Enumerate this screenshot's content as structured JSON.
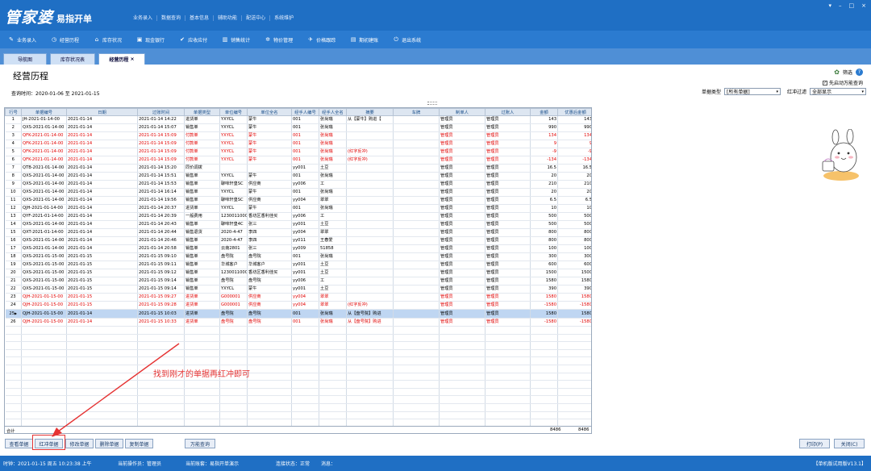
{
  "app": {
    "logo": "管家婆",
    "subtitle": "易指开单",
    "top_menu": [
      "业务录入",
      "数据查询",
      "基本信息",
      "辅助功能",
      "配送中心",
      "系统维护"
    ],
    "window_controls": [
      "▾",
      "–",
      "□",
      "×"
    ]
  },
  "toolbar": [
    {
      "label": "业务录入",
      "icon": "pencil-icon"
    },
    {
      "label": "经营历程",
      "icon": "clock-icon"
    },
    {
      "label": "库存状况",
      "icon": "house-icon"
    },
    {
      "label": "现金银行",
      "icon": "cash-icon"
    },
    {
      "label": "应收应付",
      "icon": "check-icon"
    },
    {
      "label": "销售统计",
      "icon": "chart-icon"
    },
    {
      "label": "物价管理",
      "icon": "gear-icon"
    },
    {
      "label": "价格跟踪",
      "icon": "pin-icon"
    },
    {
      "label": "期初建账",
      "icon": "ledger-icon"
    },
    {
      "label": "退出系统",
      "icon": "power-icon"
    }
  ],
  "tabs": [
    {
      "label": "导航图"
    },
    {
      "label": "库存状况表"
    },
    {
      "label": "经营历程",
      "close": "×"
    }
  ],
  "page": {
    "title": "经营历程",
    "query_time": "查询时间：2020-01-06 至 2021-01-15",
    "filter_link": "筛选",
    "help": "?",
    "checkbox_label": "先启动万能查询",
    "check": "✓"
  },
  "filters": {
    "type_label": "单据类型",
    "type_value": "[所有单据]",
    "redflush_label": "红冲过滤",
    "redflush_value": "全部显示",
    "arrow": "▾"
  },
  "columns": [
    "行号",
    "单据编号",
    "日期",
    "过账时间",
    "单据类型",
    "单位编号",
    "单位全名",
    "经手人编号",
    "经手人全名",
    "摘要",
    "车牌",
    "制单人",
    "过账人",
    "金额",
    "优惠后金额"
  ],
  "rows": [
    {
      "n": "1",
      "no": "JH-2021-01-14-00",
      "d": "2021-01-14",
      "t": "2021-01-14 14:22",
      "type": "进货单",
      "uc": "YXYCL",
      "un": "蒙牛",
      "hc": "001",
      "hn": "张尚瑞",
      "memo": "从【蒙牛】购进【",
      "plate": "",
      "mk": "管理员",
      "pa": "管理员",
      "amt": "143",
      "amt2": "143",
      "red": false
    },
    {
      "n": "2",
      "no": "QXS-2021-01-14-00",
      "d": "2021-01-14",
      "t": "2021-01-14 15:07",
      "type": "销售单",
      "uc": "YXYCL",
      "un": "蒙牛",
      "hc": "001",
      "hn": "张尚瑞",
      "memo": "",
      "plate": "",
      "mk": "管理员",
      "pa": "管理员",
      "amt": "990",
      "amt2": "990",
      "red": false
    },
    {
      "n": "3",
      "no": "QFK-2021-01-14-00",
      "d": "2021-01-14",
      "t": "2021-01-14 15:09",
      "type": "付款单",
      "uc": "YXYCL",
      "un": "蒙牛",
      "hc": "001",
      "hn": "张尚瑞",
      "memo": "",
      "plate": "",
      "mk": "管理员",
      "pa": "管理员",
      "amt": "134",
      "amt2": "134",
      "red": true
    },
    {
      "n": "4",
      "no": "QFK-2021-01-14-00",
      "d": "2021-01-14",
      "t": "2021-01-14 15:09",
      "type": "付款单",
      "uc": "YXYCL",
      "un": "蒙牛",
      "hc": "001",
      "hn": "张尚瑞",
      "memo": "",
      "plate": "",
      "mk": "管理员",
      "pa": "管理员",
      "amt": "9",
      "amt2": "9",
      "red": true
    },
    {
      "n": "5",
      "no": "QFK-2021-01-14-00",
      "d": "2021-01-14",
      "t": "2021-01-14 15:09",
      "type": "付款单",
      "uc": "YXYCL",
      "un": "蒙牛",
      "hc": "001",
      "hn": "张尚瑞",
      "memo": "(红字反冲)",
      "plate": "",
      "mk": "管理员",
      "pa": "管理员",
      "amt": "-9",
      "amt2": "-9",
      "red": true
    },
    {
      "n": "6",
      "no": "QFK-2021-01-14-00",
      "d": "2021-01-14",
      "t": "2021-01-14 15:09",
      "type": "付款单",
      "uc": "YXYCL",
      "un": "蒙牛",
      "hc": "001",
      "hn": "张尚瑞",
      "memo": "(红字反冲)",
      "plate": "",
      "mk": "管理员",
      "pa": "管理员",
      "amt": "-134",
      "amt2": "-134",
      "red": true
    },
    {
      "n": "7",
      "no": "QTB-2021-01-14-00",
      "d": "2021-01-14",
      "t": "2021-01-14 15:20",
      "type": "同价调拨",
      "uc": "",
      "un": "",
      "hc": "yy001",
      "hn": "土豆",
      "memo": "",
      "plate": "",
      "mk": "管理员",
      "pa": "管理员",
      "amt": "16.5",
      "amt2": "16.5",
      "red": false
    },
    {
      "n": "8",
      "no": "QXS-2021-01-14-00",
      "d": "2021-01-14",
      "t": "2021-01-14 15:51",
      "type": "销售单",
      "uc": "YXYCL",
      "un": "蒙牛",
      "hc": "001",
      "hn": "张尚瑞",
      "memo": "",
      "plate": "",
      "mk": "管理员",
      "pa": "管理员",
      "amt": "20",
      "amt2": "20",
      "red": false
    },
    {
      "n": "9",
      "no": "QXS-2021-01-14-00",
      "d": "2021-01-14",
      "t": "2021-01-14 15:53",
      "type": "销售单",
      "uc": "聊味轩皇SC",
      "un": "供应商",
      "hc": "yy006",
      "hn": "工",
      "memo": "",
      "plate": "",
      "mk": "管理员",
      "pa": "管理员",
      "amt": "210",
      "amt2": "210",
      "red": false
    },
    {
      "n": "10",
      "no": "QXS-2021-01-14-00",
      "d": "2021-01-14",
      "t": "2021-01-14 16:14",
      "type": "销售单",
      "uc": "YXYCL",
      "un": "蒙牛",
      "hc": "001",
      "hn": "张尚瑞",
      "memo": "",
      "plate": "",
      "mk": "管理员",
      "pa": "管理员",
      "amt": "20",
      "amt2": "20",
      "red": false
    },
    {
      "n": "11",
      "no": "QXS-2021-01-14-00",
      "d": "2021-01-14",
      "t": "2021-01-14 19:56",
      "type": "销售单",
      "uc": "聊味轩皇SC",
      "un": "供应商",
      "hc": "yy004",
      "hn": "翠翠",
      "memo": "",
      "plate": "",
      "mk": "管理员",
      "pa": "管理员",
      "amt": "6.5",
      "amt2": "6.5",
      "red": false
    },
    {
      "n": "12",
      "no": "QJH-2021-01-14-00",
      "d": "2021-01-14",
      "t": "2021-01-14 20:37",
      "type": "进货单",
      "uc": "YXYCL",
      "un": "蒙牛",
      "hc": "001",
      "hn": "张尚瑞",
      "memo": "",
      "plate": "",
      "mk": "管理员",
      "pa": "管理员",
      "amt": "10",
      "amt2": "10",
      "red": false
    },
    {
      "n": "13",
      "no": "QYF-2021-01-14-00",
      "d": "2021-01-14",
      "t": "2021-01-14 20:39",
      "type": "一般费用",
      "uc": "12300110003",
      "un": "香坊区香利佳买",
      "hc": "yy006",
      "hn": "工",
      "memo": "",
      "plate": "",
      "mk": "管理员",
      "pa": "管理员",
      "amt": "500",
      "amt2": "500",
      "red": false
    },
    {
      "n": "14",
      "no": "QXS-2021-01-14-00",
      "d": "2021-01-14",
      "t": "2021-01-14 20:43",
      "type": "销售单",
      "uc": "聊味轩皇4C",
      "un": "张三",
      "hc": "yy001",
      "hn": "土豆",
      "memo": "",
      "plate": "",
      "mk": "管理员",
      "pa": "管理员",
      "amt": "500",
      "amt2": "500",
      "red": false
    },
    {
      "n": "15",
      "no": "QXT-2021-01-14-00",
      "d": "2021-01-14",
      "t": "2021-01-14 20:44",
      "type": "销售退货",
      "uc": "2020-4-47",
      "un": "李四",
      "hc": "yy004",
      "hn": "翠翠",
      "memo": "",
      "plate": "",
      "mk": "管理员",
      "pa": "管理员",
      "amt": "800",
      "amt2": "800",
      "red": false
    },
    {
      "n": "16",
      "no": "QXS-2021-01-14-00",
      "d": "2021-01-14",
      "t": "2021-01-14 20:46",
      "type": "销售单",
      "uc": "2020-4-47",
      "un": "李四",
      "hc": "yy011",
      "hn": "王春爱",
      "memo": "",
      "plate": "",
      "mk": "管理员",
      "pa": "管理员",
      "amt": "800",
      "amt2": "800",
      "red": false
    },
    {
      "n": "17",
      "no": "QXS-2021-01-14-00",
      "d": "2021-01-14",
      "t": "2021-01-14 20:58",
      "type": "销售单",
      "uc": "云南2801",
      "un": "张三",
      "hc": "yy009",
      "hn": "51858",
      "memo": "",
      "plate": "",
      "mk": "管理员",
      "pa": "管理员",
      "amt": "100",
      "amt2": "100",
      "red": false
    },
    {
      "n": "18",
      "no": "QXS-2021-01-15-00",
      "d": "2021-01-15",
      "t": "2021-01-15 09:10",
      "type": "销售单",
      "uc": "盘号院",
      "un": "盘号院",
      "hc": "001",
      "hn": "张尚瑞",
      "memo": "",
      "plate": "",
      "mk": "管理员",
      "pa": "管理员",
      "amt": "300",
      "amt2": "300",
      "red": false
    },
    {
      "n": "19",
      "no": "QXS-2021-01-15-00",
      "d": "2021-01-15",
      "t": "2021-01-15 09:11",
      "type": "销售单",
      "uc": "华城客户",
      "un": "华城客户",
      "hc": "yy001",
      "hn": "土豆",
      "memo": "",
      "plate": "",
      "mk": "管理员",
      "pa": "管理员",
      "amt": "600",
      "amt2": "600",
      "red": false
    },
    {
      "n": "20",
      "no": "QXS-2021-01-15-00",
      "d": "2021-01-15",
      "t": "2021-01-15 09:12",
      "type": "销售单",
      "uc": "12300110003",
      "un": "香坊区香利佳买",
      "hc": "yy001",
      "hn": "土豆",
      "memo": "",
      "plate": "",
      "mk": "管理员",
      "pa": "管理员",
      "amt": "1500",
      "amt2": "1500",
      "red": false
    },
    {
      "n": "21",
      "no": "QXS-2021-01-15-00",
      "d": "2021-01-15",
      "t": "2021-01-15 09:14",
      "type": "销售单",
      "uc": "盘号院",
      "un": "盘号院",
      "hc": "yy006",
      "hn": "工",
      "memo": "",
      "plate": "",
      "mk": "管理员",
      "pa": "管理员",
      "amt": "1580",
      "amt2": "1580",
      "red": false
    },
    {
      "n": "22",
      "no": "QXS-2021-01-15-00",
      "d": "2021-01-15",
      "t": "2021-01-15 09:14",
      "type": "销售单",
      "uc": "YXYCL",
      "un": "蒙牛",
      "hc": "yy001",
      "hn": "土豆",
      "memo": "",
      "plate": "",
      "mk": "管理员",
      "pa": "管理员",
      "amt": "390",
      "amt2": "390",
      "red": false
    },
    {
      "n": "23",
      "no": "QJH-2021-01-15-00",
      "d": "2021-01-15",
      "t": "2021-01-15 09:27",
      "type": "进货单",
      "uc": "G000001",
      "un": "供应商",
      "hc": "yy004",
      "hn": "翠翠",
      "memo": "",
      "plate": "",
      "mk": "管理员",
      "pa": "管理员",
      "amt": "1580",
      "amt2": "1580",
      "red": true
    },
    {
      "n": "24",
      "no": "QJH-2021-01-15-00",
      "d": "2021-01-15",
      "t": "2021-01-15 09:28",
      "type": "进货单",
      "uc": "G000001",
      "un": "供应商",
      "hc": "yy004",
      "hn": "翠翠",
      "memo": "(红字反冲)",
      "plate": "",
      "mk": "管理员",
      "pa": "管理员",
      "amt": "-1580",
      "amt2": "-1580",
      "red": true
    },
    {
      "n": "25",
      "no": "QJH-2021-01-15-00",
      "d": "2021-01-14",
      "t": "2021-01-15 10:03",
      "type": "进货单",
      "uc": "盘号院",
      "un": "盘号院",
      "hc": "001",
      "hn": "张尚瑞",
      "memo": "从【盘号院】购进",
      "plate": "",
      "mk": "管理员",
      "pa": "管理员",
      "amt": "1580",
      "amt2": "1580",
      "red": false,
      "selected": true,
      "pointer": "▶"
    },
    {
      "n": "26",
      "no": "QJH-2021-01-15-00",
      "d": "2021-01-14",
      "t": "2021-01-15 10:33",
      "type": "进货单",
      "uc": "盘号院",
      "un": "盘号院",
      "hc": "001",
      "hn": "张尚瑞",
      "memo": "从【盘号院】购进",
      "plate": "",
      "mk": "管理员",
      "pa": "管理员",
      "amt": "-1580",
      "amt2": "-1580",
      "red": true
    }
  ],
  "footer": {
    "label": "合计",
    "amt": "8486",
    "amt2": "8486"
  },
  "annotation": "找到刚才的单据再红冲即可",
  "buttons": [
    "查看单据",
    "红冲单据",
    "修改单据",
    "删除单据",
    "复制单据",
    "万能查询"
  ],
  "right_buttons": [
    "打印(P)",
    "关闭(C)"
  ],
  "status": {
    "time": "时钟：2021-01-15 周五 10:23:38 上午",
    "operator": "当前操作员：管理员",
    "account": "当前账套：易指开单演示",
    "conn": "连接状态：正常",
    "msg": "消息：",
    "version": "【单机版试用版V13.1】"
  },
  "colors": {
    "title_bar": "#1f6fc4",
    "toolbar": "#2b7bd0",
    "red_text": "#e00000",
    "annotation": "#e53333",
    "selected_row": "#bfd6f2"
  }
}
